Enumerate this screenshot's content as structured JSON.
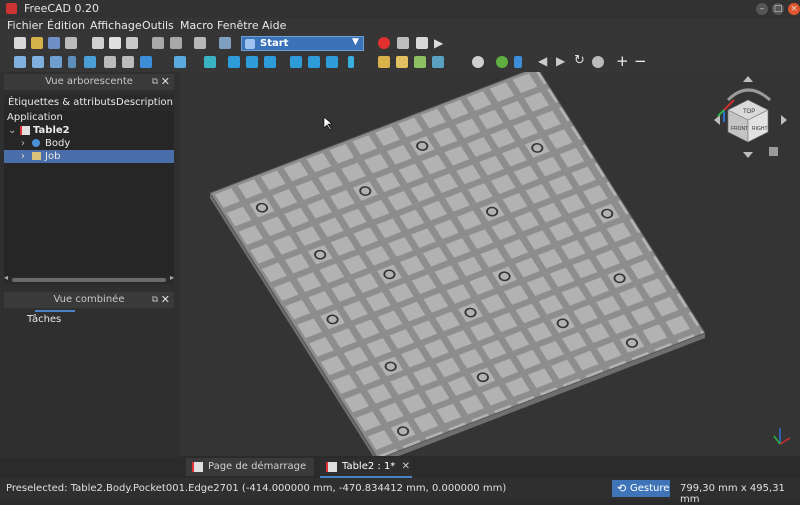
{
  "window": {
    "title": "FreeCAD 0.20"
  },
  "menu": [
    "Fichier",
    "Édition",
    "Affichage",
    "Outils",
    "Macro",
    "Fenêtre",
    "Aide"
  ],
  "toolbar": {
    "workbench": "Start"
  },
  "tree_dock": {
    "title": "Vue arborescente",
    "tabs": [
      "Étiquettes & attributs",
      "Description"
    ],
    "root": "Application",
    "items": [
      {
        "label": "Table2",
        "icon": "document-icon"
      },
      {
        "label": "Body",
        "icon": "body-icon"
      },
      {
        "label": "Job",
        "icon": "folder-icon",
        "selected": true
      }
    ]
  },
  "combo_dock": {
    "title": "Vue combinée",
    "tab": "Tâches"
  },
  "viewcube": {
    "labels": [
      "TOP",
      "FRONT",
      "RIGHT"
    ]
  },
  "document_tabs": [
    {
      "label": "Page de démarrage",
      "active": false
    },
    {
      "label": "Table2 : 1*",
      "active": true
    }
  ],
  "status": {
    "message": "Preselected: Table2.Body.Pocket001.Edge2701 (-414.000000 mm, -470.834412 mm, 0.000000 mm)",
    "navigation": "Gesture",
    "dimensions": "799,30 mm x 495,31 mm"
  },
  "colors": {
    "accent": "#4a82c9",
    "selection": "#4a6ea9",
    "plate": "#8d8d8d"
  }
}
